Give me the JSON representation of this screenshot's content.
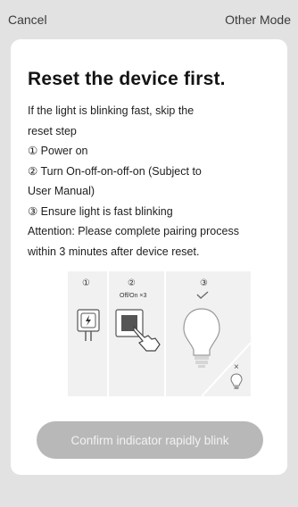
{
  "header": {
    "cancel_label": "Cancel",
    "other_mode_label": "Other Mode"
  },
  "card": {
    "title": "Reset the device first.",
    "lines": [
      "If the light is blinking fast, skip the",
      "reset step",
      "① Power on",
      "② Turn On-off-on-off-on (Subject to",
      "User Manual)",
      "③ Ensure light is fast blinking",
      "Attention: Please complete pairing process",
      "within 3 minutes after device reset."
    ],
    "illustration": {
      "step1_num": "①",
      "step2_num": "②",
      "step2_caption": "Off/On ×3",
      "step3_num": "③",
      "close_mark": "×"
    },
    "confirm_label": "Confirm indicator rapidly blink"
  },
  "colors": {
    "background": "#e2e2e2",
    "card": "#ffffff",
    "button_disabled": "#b8b8b8"
  },
  "icons": [
    "power-plug-icon",
    "wall-switch-icon",
    "hand-press-icon",
    "light-bulb-icon",
    "checkmark-icon",
    "small-bulb-icon"
  ]
}
